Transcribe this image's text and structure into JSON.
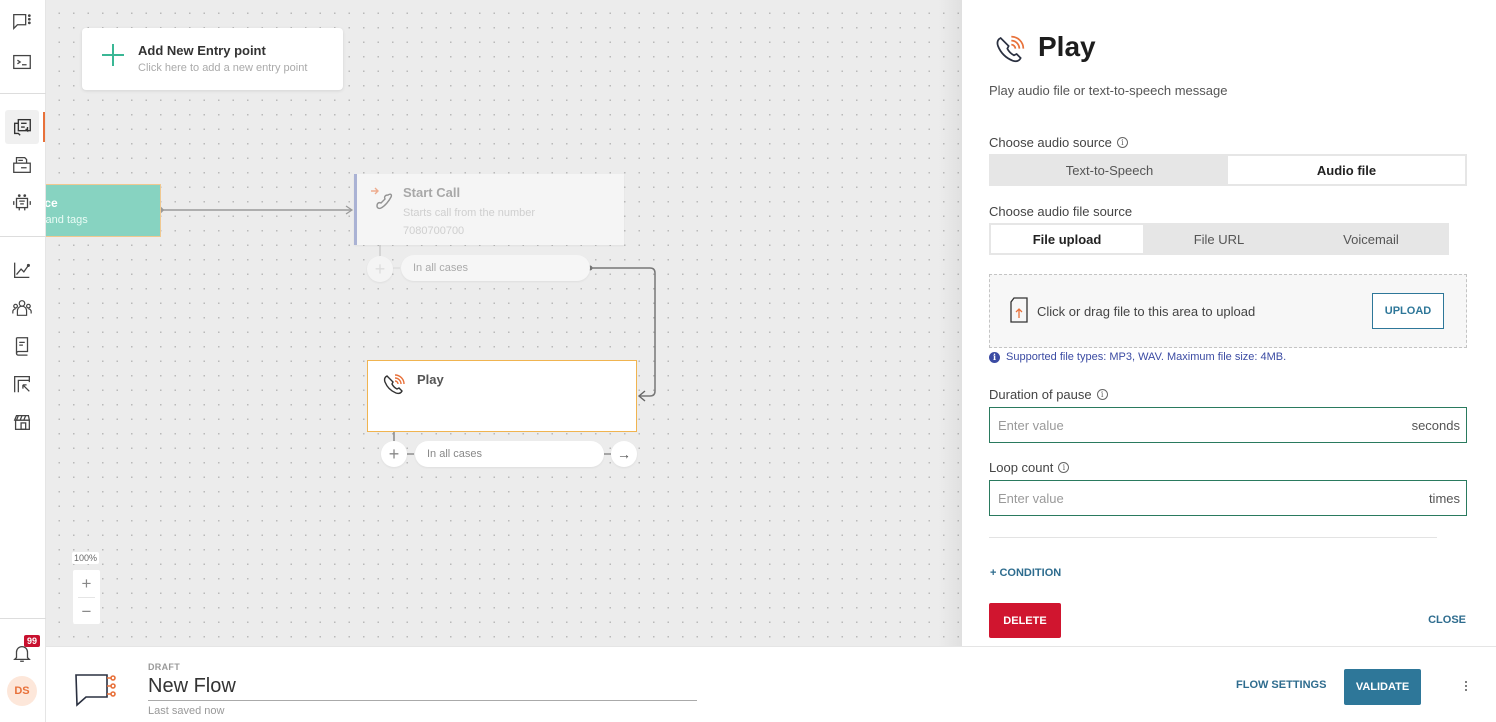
{
  "sidebar": {
    "items": [
      {
        "name": "conversations",
        "icon": "chat-dots-icon"
      },
      {
        "name": "console",
        "icon": "terminal-icon"
      },
      {
        "name": "flows",
        "icon": "flow-copy-icon",
        "active": true
      },
      {
        "name": "templates",
        "icon": "printer-icon"
      },
      {
        "name": "bots",
        "icon": "robot-icon"
      },
      {
        "name": "analytics",
        "icon": "chart-line-icon"
      },
      {
        "name": "people",
        "icon": "people-icon"
      },
      {
        "name": "docs",
        "icon": "book-icon"
      },
      {
        "name": "exports",
        "icon": "frame-arrow-icon"
      },
      {
        "name": "store",
        "icon": "store-icon"
      }
    ],
    "notifications_count": "99",
    "avatar_initials": "DS"
  },
  "canvas": {
    "entry_point": {
      "title": "Add New Entry point",
      "subtitle": "Click here to add a new entry point"
    },
    "audience_node": {
      "title": "nce",
      "subtitle": "s and tags"
    },
    "start_call_node": {
      "title": "Start Call",
      "subtitle": "Starts call from the number",
      "number": "7080700700",
      "branch": "In all cases"
    },
    "play_node": {
      "title": "Play",
      "branch": "In all cases"
    },
    "zoom_level": "100%",
    "zoom_in": "+",
    "zoom_out": "−"
  },
  "panel": {
    "title": "Play",
    "description": "Play audio file or text-to-speech message",
    "audio_source_label": "Choose audio source",
    "audio_source_options": [
      "Text-to-Speech",
      "Audio file"
    ],
    "audio_source_selected": "Audio file",
    "file_source_label": "Choose audio file source",
    "file_source_options": [
      "File upload",
      "File URL",
      "Voicemail"
    ],
    "file_source_selected": "File upload",
    "upload_text": "Click or drag file to this area to upload",
    "upload_button": "UPLOAD",
    "upload_hint": "Supported file types: MP3, WAV. Maximum file size: 4MB.",
    "pause_label": "Duration of pause",
    "pause_placeholder": "Enter value",
    "pause_suffix": "seconds",
    "loop_label": "Loop count",
    "loop_placeholder": "Enter value",
    "loop_suffix": "times",
    "condition_link": "+ CONDITION",
    "delete_button": "DELETE",
    "close_button": "CLOSE"
  },
  "footer": {
    "status": "DRAFT",
    "flow_name": "New Flow",
    "saved_text": "Last saved now",
    "flow_settings": "FLOW SETTINGS",
    "validate": "VALIDATE"
  },
  "colors": {
    "accent_orange": "#e8713a",
    "primary_blue": "#2e7799",
    "danger_red": "#d0152f",
    "field_border_green": "#2a7a5e",
    "audience_teal": "#87d3c1"
  }
}
